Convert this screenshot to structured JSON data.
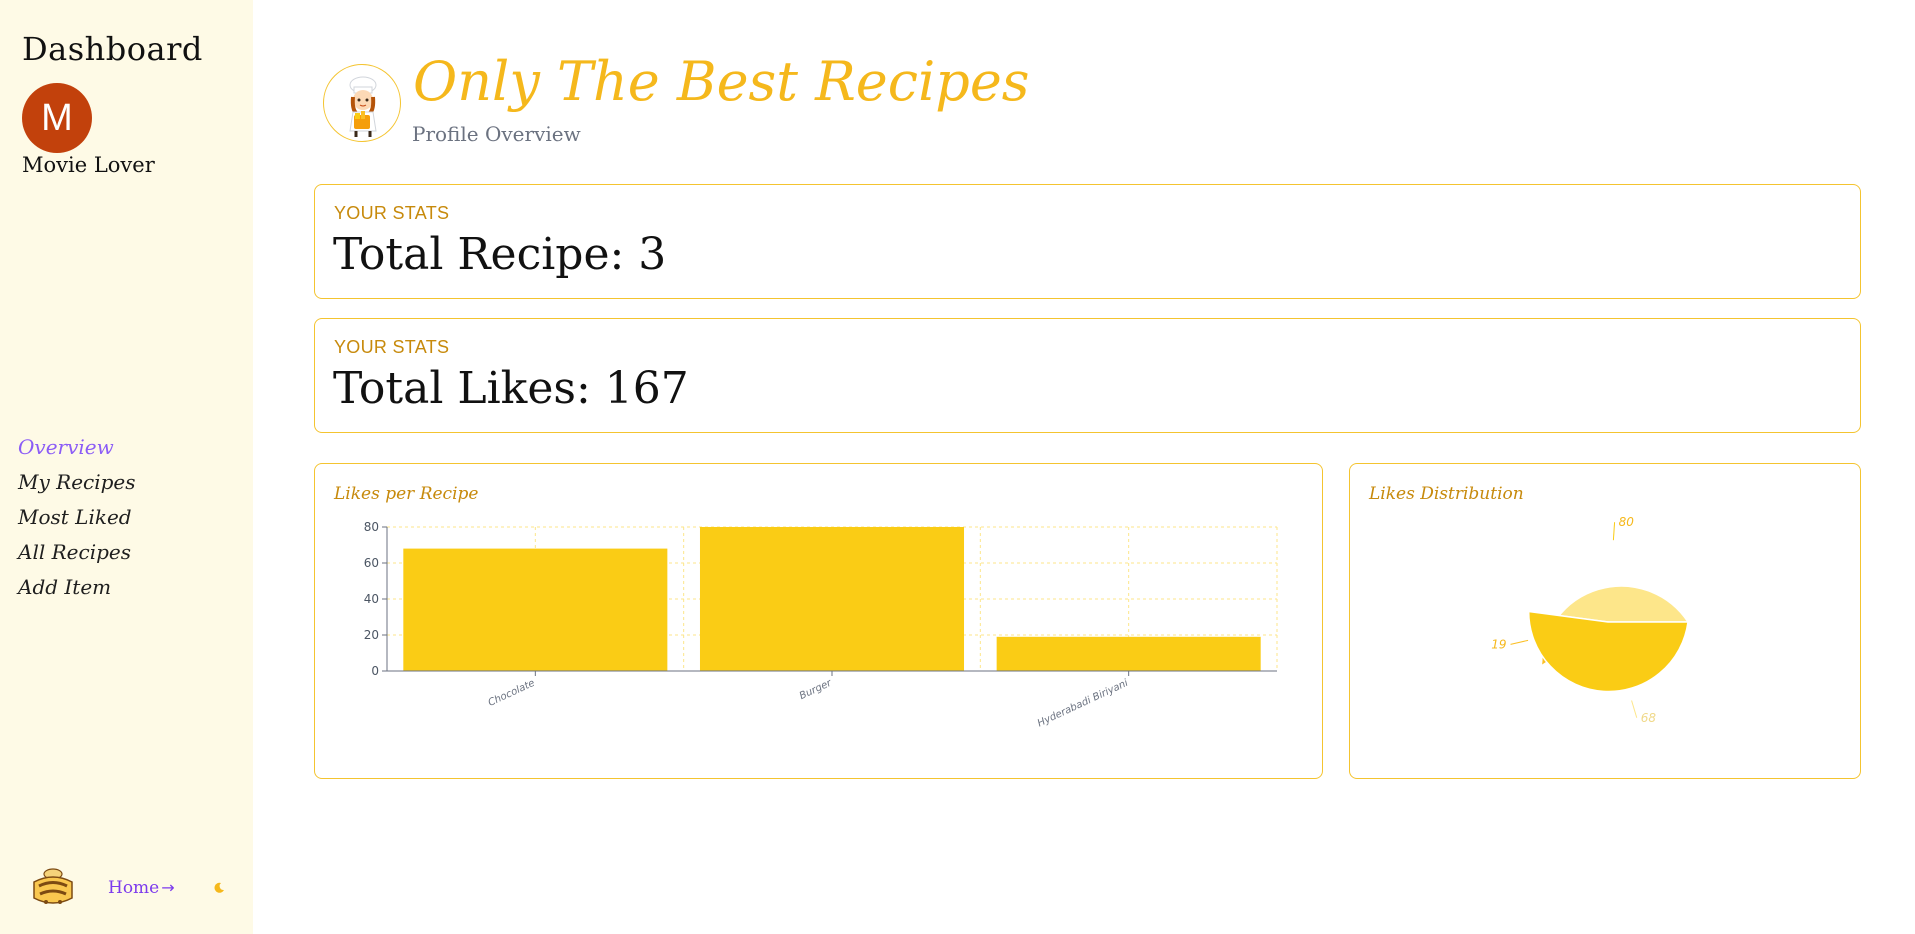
{
  "sidebar": {
    "title": "Dashboard",
    "avatar_letter": "M",
    "user_name": "Movie Lover",
    "nav": [
      {
        "label": "Overview",
        "active": true
      },
      {
        "label": "My Recipes",
        "active": false
      },
      {
        "label": "Most Liked",
        "active": false
      },
      {
        "label": "All Recipes",
        "active": false
      },
      {
        "label": "Add Item",
        "active": false
      }
    ],
    "footer": {
      "home_label": "Home",
      "home_arrow": "→",
      "logo_icon": "goodie-logo-icon",
      "theme_icon": "moon-icon"
    }
  },
  "header": {
    "title": "Only The Best Recipes",
    "subtitle": "Profile Overview",
    "chef_icon": "chef-illustration-icon"
  },
  "stats": [
    {
      "label": "YOUR STATS",
      "value": "Total Recipe: 3"
    },
    {
      "label": "YOUR STATS",
      "value": "Total Likes: 167"
    }
  ],
  "colors": {
    "accent": "#f5b81c",
    "bar": "#facc15",
    "label": "#c78a0c",
    "nav_active": "#8b5cf6",
    "sidebar_bg": "#fefae6",
    "avatar": "#c2410c",
    "pie": [
      "#fde68a",
      "#fbbf24",
      "#facc15"
    ]
  },
  "chart_data": [
    {
      "type": "bar",
      "title": "Likes per Recipe",
      "categories": [
        "Chocolate",
        "Burger",
        "Hyderabadi Biriyani"
      ],
      "values": [
        68,
        80,
        19
      ],
      "yticks": [
        0,
        20,
        40,
        60,
        80
      ],
      "ylim": [
        0,
        80
      ],
      "grid": true,
      "xlabel": "",
      "ylabel": ""
    },
    {
      "type": "pie",
      "title": "Likes Distribution",
      "labels": [
        "Chocolate",
        "Hyderabadi Biriyani",
        "Burger"
      ],
      "values": [
        68,
        19,
        80
      ]
    }
  ]
}
